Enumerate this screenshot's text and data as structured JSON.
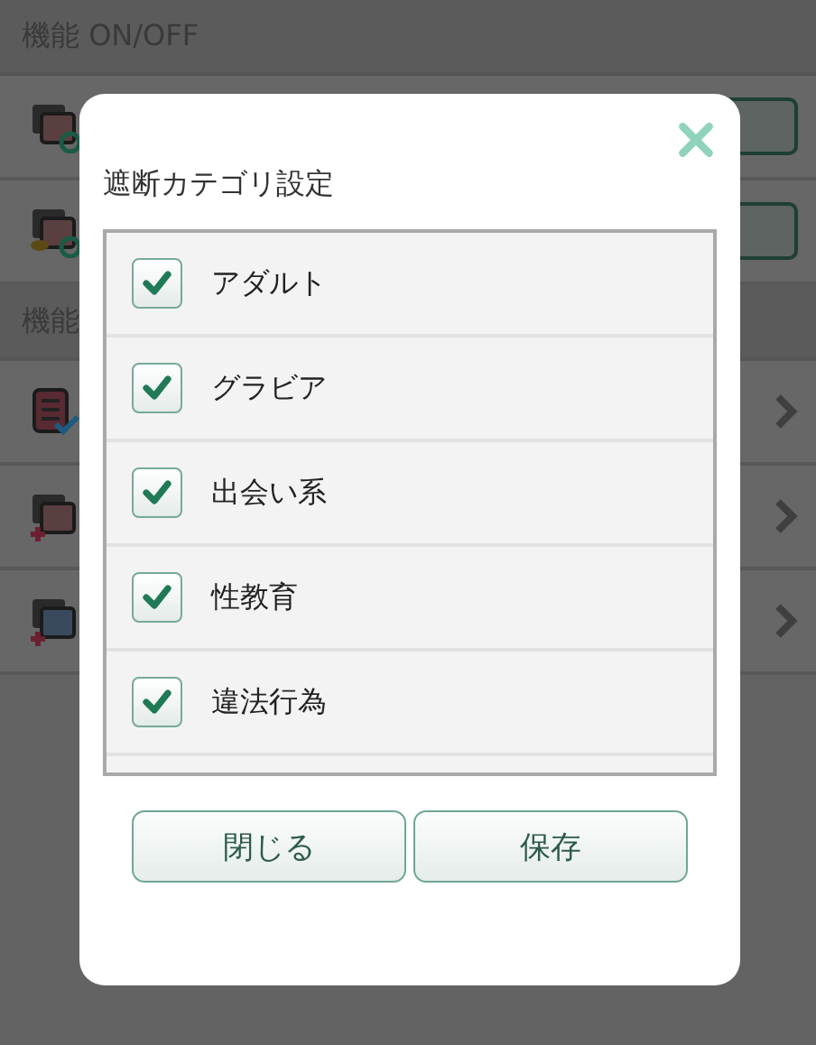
{
  "sections": [
    {
      "title": "機能 ON/OFF",
      "rows": [
        {
          "kind": "toggle"
        },
        {
          "kind": "toggle"
        }
      ]
    },
    {
      "title": "機能",
      "rows": [
        {
          "kind": "link"
        },
        {
          "kind": "link"
        },
        {
          "kind": "link"
        }
      ]
    }
  ],
  "dialog": {
    "title": "遮断カテゴリ設定",
    "categories": [
      {
        "label": "アダルト",
        "checked": true
      },
      {
        "label": "グラビア",
        "checked": true
      },
      {
        "label": "出会い系",
        "checked": true
      },
      {
        "label": "性教育",
        "checked": true
      },
      {
        "label": "違法行為",
        "checked": true
      }
    ],
    "buttons": [
      "閉じる",
      "保存"
    ]
  }
}
